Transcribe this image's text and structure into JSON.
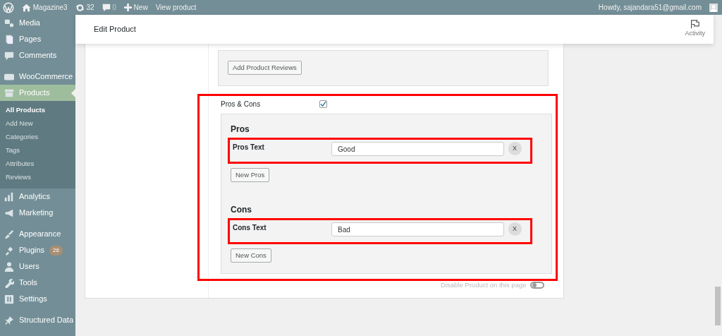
{
  "admin_bar": {
    "site": "Magazine3",
    "updates": "32",
    "comments": "0",
    "new": "New",
    "view": "View product",
    "greeting": "Howdy, sajandara51@gmail.com"
  },
  "sidebar": {
    "groups": [
      [
        {
          "label": "Media",
          "selected": false
        },
        {
          "label": "Pages",
          "selected": false
        },
        {
          "label": "Comments",
          "selected": false
        }
      ],
      [
        {
          "label": "WooCommerce",
          "selected": false
        },
        {
          "label": "Products",
          "selected": true,
          "submenu": [
            {
              "label": "All Products",
              "selected": true
            },
            {
              "label": "Add New",
              "selected": false
            },
            {
              "label": "Categories",
              "selected": false
            },
            {
              "label": "Tags",
              "selected": false
            },
            {
              "label": "Attributes",
              "selected": false
            },
            {
              "label": "Reviews",
              "selected": false
            }
          ]
        },
        {
          "label": "Analytics",
          "selected": false
        },
        {
          "label": "Marketing",
          "selected": false
        }
      ],
      [
        {
          "label": "Appearance",
          "selected": false
        },
        {
          "label": "Plugins",
          "selected": false,
          "badge": "26"
        },
        {
          "label": "Users",
          "selected": false
        },
        {
          "label": "Tools",
          "selected": false
        },
        {
          "label": "Settings",
          "selected": false
        }
      ],
      [
        {
          "label": "Structured Data",
          "selected": false
        }
      ]
    ]
  },
  "header": {
    "title": "Edit Product",
    "activity": "Activity"
  },
  "reviews_button": "Add Product Reviews",
  "pros_cons": {
    "label": "Pros & Cons",
    "checked": true,
    "highlighted": true,
    "groups": [
      {
        "title": "Pros",
        "rows": [
          {
            "label": "Pros Text",
            "value": "Good",
            "remove": "X",
            "highlighted": true
          }
        ],
        "add_button": "New Pros"
      },
      {
        "title": "Cons",
        "rows": [
          {
            "label": "Cons Text",
            "value": "Bad",
            "remove": "X",
            "highlighted": true
          }
        ],
        "add_button": "New Cons"
      }
    ]
  },
  "disable_toggle": {
    "label": "Disable Product on this page",
    "on": false
  }
}
